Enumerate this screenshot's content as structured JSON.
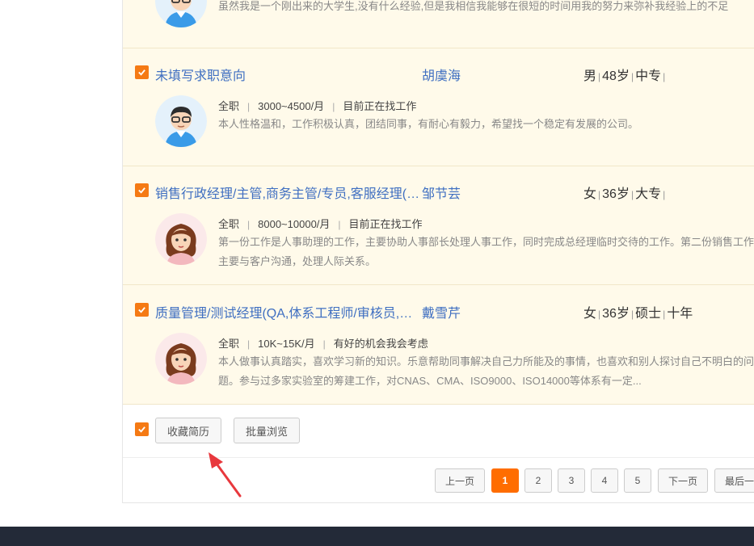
{
  "candidates": [
    {
      "description": "虽然我是一个刚出来的大学生,没有什么经验,但是我相信我能够在很短的时间用我的努力来弥补我经验上的不足"
    },
    {
      "title": "未填写求职意向",
      "name": "胡虞海",
      "gender": "男",
      "age": "48岁",
      "education": "中专",
      "experience": "",
      "job_type": "全职",
      "salary": "3000~4500/月",
      "status": "目前正在找工作",
      "description": "本人性格温和，工作积极认真，团结同事，有耐心有毅力，希望找一个稳定有发展的公司。"
    },
    {
      "title": "销售行政经理/主管,商务主管/专员,客服经理(…",
      "name": "邹节芸",
      "gender": "女",
      "age": "36岁",
      "education": "大专",
      "experience": "",
      "job_type": "全职",
      "salary": "8000~10000/月",
      "status": "目前正在找工作",
      "description": "第一份工作是人事助理的工作，主要协助人事部长处理人事工作，同时完成总经理临时交待的工作。第二份销售工作，主要与客户沟通，处理人际关系。"
    },
    {
      "title": "质量管理/测试经理(QA,体系工程师/审核员,…",
      "name": "戴雪芹",
      "gender": "女",
      "age": "36岁",
      "education": "硕士",
      "experience": "十年",
      "job_type": "全职",
      "salary": "10K~15K/月",
      "status": "有好的机会我会考虑",
      "description": "本人做事认真踏实，喜欢学习新的知识。乐意帮助同事解决自己力所能及的事情，也喜欢和别人探讨自己不明白的问题。参与过多家实验室的筹建工作，对CNAS、CMA、ISO9000、ISO14000等体系有一定..."
    }
  ],
  "actions": {
    "collect_label": "收藏简历",
    "batch_view_label": "批量浏览"
  },
  "pagination": {
    "prev_label": "上一页",
    "pages": [
      "1",
      "2",
      "3",
      "4",
      "5"
    ],
    "current": "1",
    "next_label": "下一页",
    "last_label": "最后一页"
  },
  "colors": {
    "accent": "#f57a14",
    "active_page": "#ff6d00",
    "link": "#3f6fc1",
    "card_bg": "#fffaea",
    "footer": "#232a38"
  },
  "icons": [
    "checkbox-checked-icon",
    "avatar-male-icon",
    "avatar-female-icon",
    "arrow-annotation-icon"
  ]
}
